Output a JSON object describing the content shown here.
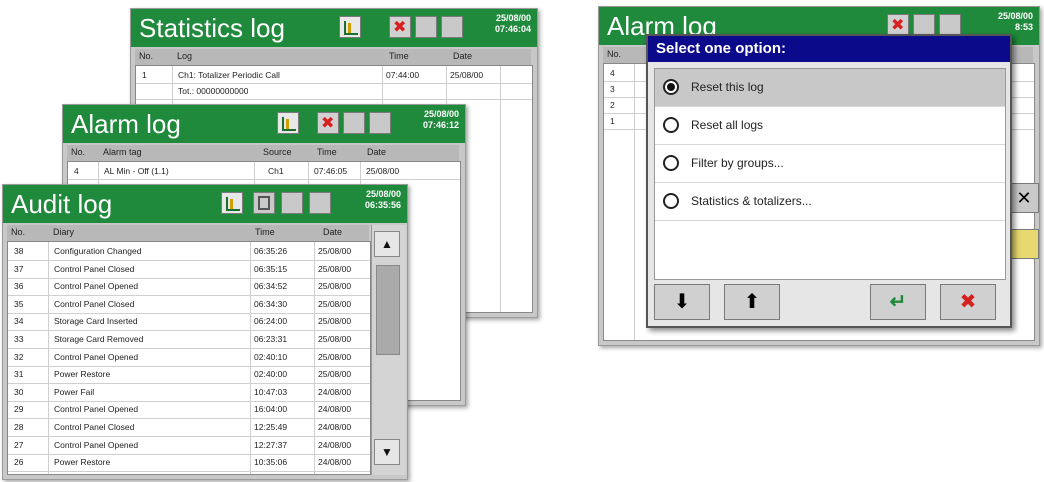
{
  "statistics_log": {
    "title": "Statistics log",
    "date": "25/08/00",
    "time": "07:46:04",
    "columns": [
      "No.",
      "Log",
      "Time",
      "Date"
    ],
    "rows": [
      [
        "1",
        "Ch1: Totalizer Periodic Call",
        "07:44:00",
        "25/08/00"
      ],
      [
        "",
        "Tot.: 00000000000",
        "",
        ""
      ]
    ]
  },
  "alarm_log": {
    "title": "Alarm log",
    "date": "25/08/00",
    "time": "07:46:12",
    "columns": [
      "No.",
      "Alarm tag",
      "Source",
      "Time",
      "Date"
    ],
    "rows": [
      [
        "4",
        "AL Min - Off (1.1)",
        "Ch1",
        "07:46:05",
        "25/08/00"
      ]
    ]
  },
  "audit_log": {
    "title": "Audit log",
    "date": "25/08/00",
    "time": "06:35:56",
    "columns": [
      "No.",
      "Diary",
      "Time",
      "Date"
    ],
    "rows": [
      [
        "38",
        "Configuration Changed",
        "06:35:26",
        "25/08/00"
      ],
      [
        "37",
        "Control Panel Closed",
        "06:35:15",
        "25/08/00"
      ],
      [
        "36",
        "Control Panel Opened",
        "06:34:52",
        "25/08/00"
      ],
      [
        "35",
        "Control Panel Closed",
        "06:34:30",
        "25/08/00"
      ],
      [
        "34",
        "Storage Card Inserted",
        "06:24:00",
        "25/08/00"
      ],
      [
        "33",
        "Storage Card Removed",
        "06:23:31",
        "25/08/00"
      ],
      [
        "32",
        "Control Panel Opened",
        "02:40:10",
        "25/08/00"
      ],
      [
        "31",
        "Power Restore",
        "02:40:00",
        "25/08/00"
      ],
      [
        "30",
        "Power Fail",
        "10:47:03",
        "24/08/00"
      ],
      [
        "29",
        "Control Panel Opened",
        "16:04:00",
        "24/08/00"
      ],
      [
        "28",
        "Control Panel Closed",
        "12:25:49",
        "24/08/00"
      ],
      [
        "27",
        "Control Panel Opened",
        "12:27:37",
        "24/08/00"
      ],
      [
        "26",
        "Power Restore",
        "10:35:06",
        "24/08/00"
      ]
    ]
  },
  "right_alarm_log": {
    "title": "Alarm log",
    "date": "25/08/00",
    "time": "8:53",
    "columns": [
      "No."
    ],
    "row_numbers": [
      "4",
      "3",
      "2",
      "1"
    ]
  },
  "dialog": {
    "title": "Select one option:",
    "options": [
      "Reset this log",
      "Reset all logs",
      "Filter by groups...",
      "Statistics & totalizers..."
    ],
    "selected_index": 0,
    "buttons": {
      "down": "⬇",
      "up": "⬆",
      "enter": "↵",
      "cancel": "✖"
    }
  },
  "colors": {
    "titlebar": "#1f8a3c",
    "dialog_title": "#0a0a8a",
    "cancel": "#d62020",
    "enter": "#1f8a3c"
  }
}
